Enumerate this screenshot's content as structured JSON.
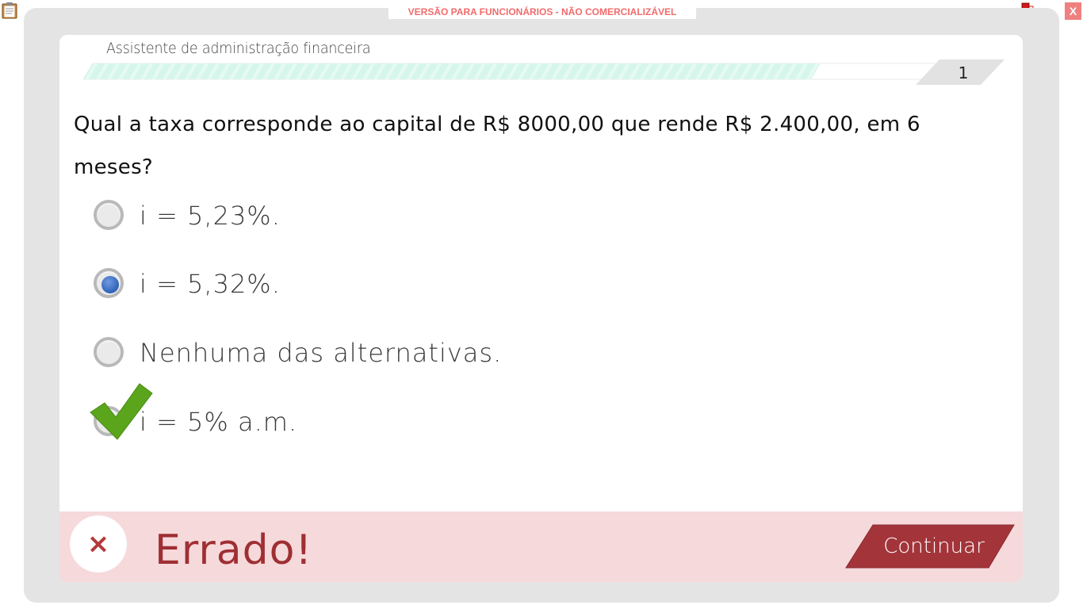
{
  "topbar": {
    "banner_text": "VERSÃO PARA FUNCIONÁRIOS - NÃO COMERCIALIZÁVEL",
    "close_label": "X"
  },
  "header": {
    "module_title": "Assistente de administração financeira",
    "page_number": "1",
    "progress_fraction": 0.85
  },
  "question": {
    "text": "Qual a taxa corresponde ao capital de R$ 8000,00 que rende R$ 2.400,00, em 6 meses?"
  },
  "options": [
    {
      "label": "i = 5,23%.",
      "selected": false,
      "correct": false
    },
    {
      "label": "i = 5,32%.",
      "selected": true,
      "correct": false
    },
    {
      "label": "Nenhuma das alternativas.",
      "selected": false,
      "correct": false
    },
    {
      "label": "i = 5% a.m.",
      "selected": false,
      "correct": true
    }
  ],
  "feedback": {
    "icon_label": "×",
    "result_text": "Errado!",
    "continue_label": "Continuar"
  },
  "colors": {
    "banner_text": "#f26b6b",
    "progress_fill": "#d9f7ee",
    "feedback_bg": "#f6d9db",
    "feedback_text": "#9e2f33",
    "continue_bg": "#a3353a",
    "radio_selected": "#2f62b8",
    "check": "#5aa51c"
  }
}
